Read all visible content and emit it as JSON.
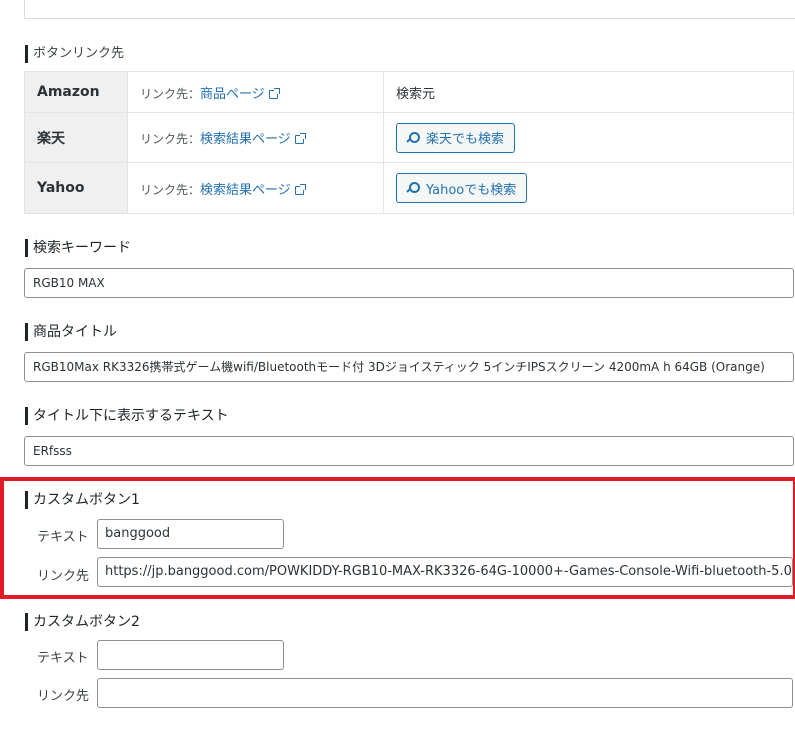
{
  "button_links": {
    "heading": "ボタンリンク先",
    "rows": [
      {
        "store": "Amazon",
        "dest_prefix": "リンク先：",
        "dest_link": "商品ページ",
        "search_text": "検索元"
      },
      {
        "store": "楽天",
        "dest_prefix": "リンク先：",
        "dest_link": "検索結果ページ",
        "search_button": "楽天でも検索"
      },
      {
        "store": "Yahoo",
        "dest_prefix": "リンク先：",
        "dest_link": "検索結果ページ",
        "search_button": "Yahooでも検索"
      }
    ]
  },
  "search_keyword": {
    "label": "検索キーワード",
    "value": "RGB10 MAX"
  },
  "product_title": {
    "label": "商品タイトル",
    "value": "RGB10Max RK3326携帯式ゲーム機wifi/Bluetoothモード付 3Dジョイスティック 5インチIPSスクリーン 4200mA h  64GB (Orange)"
  },
  "subtitle_text": {
    "label": "タイトル下に表示するテキスト",
    "value": "ERfsss"
  },
  "custom_button_1": {
    "heading": "カスタムボタン1",
    "text_label": "テキスト",
    "text_value": "banggood",
    "link_label": "リンク先",
    "link_value": "https://jp.banggood.com/POWKIDDY-RGB10-MAX-RK3326-64G-10000+-Games-Console-Wifi-bluetooth-5.0"
  },
  "custom_button_2": {
    "heading": "カスタムボタン2",
    "text_label": "テキスト",
    "text_value": "",
    "link_label": "リンク先",
    "link_value": ""
  },
  "colors": {
    "link": "#2271b1",
    "highlight_border": "#e21c24"
  },
  "icons": [
    "external-link-icon",
    "search-icon"
  ]
}
